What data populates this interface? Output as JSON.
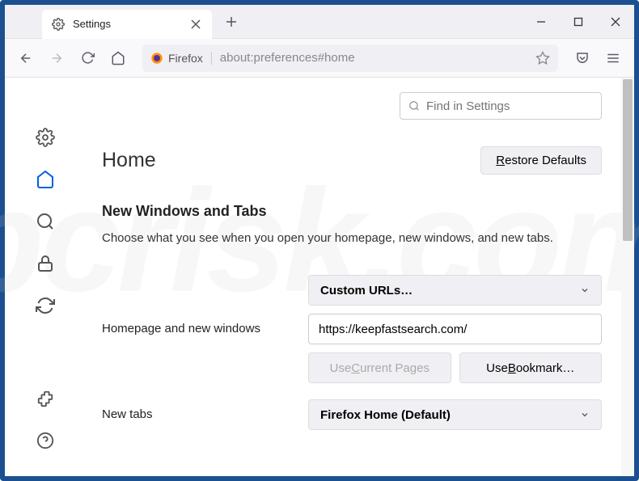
{
  "tab": {
    "title": "Settings"
  },
  "toolbar": {
    "firefox_label": "Firefox",
    "url": "about:preferences#home"
  },
  "search": {
    "placeholder": "Find in Settings"
  },
  "page": {
    "title": "Home",
    "restore": "Restore Defaults",
    "section_title": "New Windows and Tabs",
    "section_desc": "Choose what you see when you open your homepage, new windows, and new tabs."
  },
  "homepage": {
    "label": "Homepage and new windows",
    "select": "Custom URLs…",
    "url": "https://keepfastsearch.com/",
    "use_current": "Use Current Pages",
    "use_bookmark": "Use Bookmark…"
  },
  "newtabs": {
    "label": "New tabs",
    "select": "Firefox Home (Default)"
  }
}
